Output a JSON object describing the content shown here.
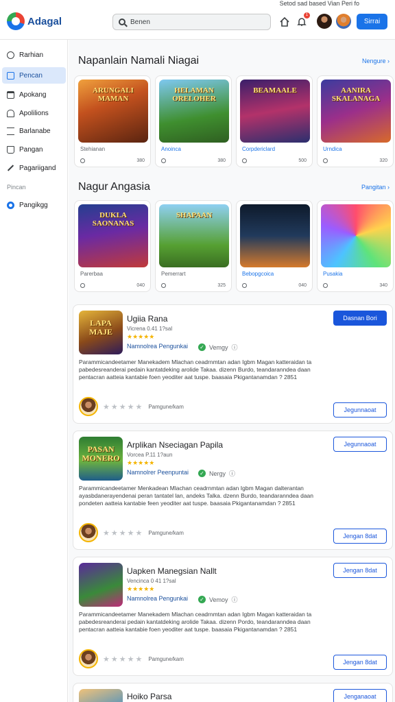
{
  "header": {
    "top_note": "Setod sad based Vian Peri fo",
    "logo_text": "Adagal",
    "search_value": "Benen",
    "notif_count": "1",
    "primary_button": "Sirrai"
  },
  "sidebar": {
    "items": [
      {
        "label": "Rarhian",
        "icon": "search-icon"
      },
      {
        "label": "Pencan",
        "icon": "document-icon"
      },
      {
        "label": "Apokang",
        "icon": "calendar-icon"
      },
      {
        "label": "Apolilions",
        "icon": "bell-icon"
      },
      {
        "label": "Barlanabe",
        "icon": "list-icon"
      },
      {
        "label": "Pangan",
        "icon": "bag-icon"
      },
      {
        "label": "Pagariigand",
        "icon": "pencil-icon"
      }
    ],
    "section_label": "Pincan",
    "radio_item": "Pangikgg"
  },
  "sections": [
    {
      "title": "Napanlain Namali Niagai",
      "link": "Nengure",
      "tiles": [
        {
          "art": "ARUNGALI MAMAN",
          "name": "Stehianan",
          "count": "380"
        },
        {
          "art": "HELAMAN ORELOHER",
          "name": "Anoinca",
          "count": "380"
        },
        {
          "art": "BEAMAALE",
          "name": "Corpdericlard",
          "count": "500"
        },
        {
          "art": "AANIRA SKALANAGA",
          "name": "Urndica",
          "count": "320"
        }
      ]
    },
    {
      "title": "Nagur Angasia",
      "link": "Pangitan",
      "tiles": [
        {
          "art": "DUKLA SAONANAS",
          "name": "Parerbaa",
          "count": "040"
        },
        {
          "art": "SHAPAAN",
          "name": "Pemerrart",
          "count": "325"
        },
        {
          "art": "",
          "name": "Bebopgcoica",
          "count": "040"
        },
        {
          "art": "",
          "name": "Pusakia",
          "count": "340"
        }
      ]
    }
  ],
  "apps": [
    {
      "art": "LAPA MAJE",
      "title": "Ugiia Rana",
      "sub": "Vicrena 0.41 1?sal",
      "stars": "★★★★★",
      "dev": "Namnolrea Pengunkai",
      "verify": "Vemgy",
      "desc": "Parammicandeetamer Manekadem Mlachan ceadrnmtan adan Igbm Magan katteraidan ta pabedesreanderai pedain kantatdeking arolide Takaa. dizenn Burdo, teandaranndea daan pentacran aatteia kantabie foen yeoditer aat tuspe. baasaia Pkigantanamdan ? 2851",
      "rate_label": "Pamgune/kam",
      "button": "Dasnan Bori"
    },
    {
      "art": "PASAN MONERO",
      "title": "Arplikan Nseciagan Papila",
      "sub": "Vorcea P.11 1?aun",
      "stars": "★★★★★",
      "dev": "Namnolrer Peenpuntai",
      "verify": "Nergy",
      "desc": "Parammicandeetamer Menkadean Mlachan ceadrnmtan adan Igbm Magan dalterantan ayasbdanerayendenai peran tantatel lan, andeks Talka. dzenn Burdo, teandaranndea daan pondeten aatteia kantabie feen yeoditer aat tuspe. baasaia Pkigantanamdan ? 2851",
      "rate_label": "Pamgune/kam",
      "button": "Jegunnaoat"
    },
    {
      "art": "",
      "title": "Uapken Manegsian Nallt",
      "sub": "Vencinca 0 41 1?sal",
      "stars": "★★★★★",
      "dev": "Namnolrea Pengunkai",
      "verify": "Vemoy",
      "desc": "Parammicandeetamer Manekadem Mlachan ceadrnmtan adan Igbm Magan katteraidan ta pabedesreanderai pedain kantatdeking arolide Takaa. dizenn Pordo, teandaranndea daan pentacran aatteia kantabie foen yeoditer aat tuspe. baasaia Pkigantanamdan ? 2851",
      "rate_label": "Pamgune/kam",
      "button": "Jengan 8dat"
    },
    {
      "title": "Hoiko Parsa",
      "button": "Jenganaoat"
    }
  ],
  "app_buttons_secondary": [
    "Jegunnaoat",
    "Jengan 8dat"
  ],
  "app_buttons_bottom": [
    "Jegunnaoat",
    "Jengan 8dat",
    "Jengan 8dat"
  ],
  "colors": {
    "accent": "#1a73e8",
    "button": "#1a56db",
    "star": "#f4b400",
    "active_nav": "#dbe8fb"
  }
}
